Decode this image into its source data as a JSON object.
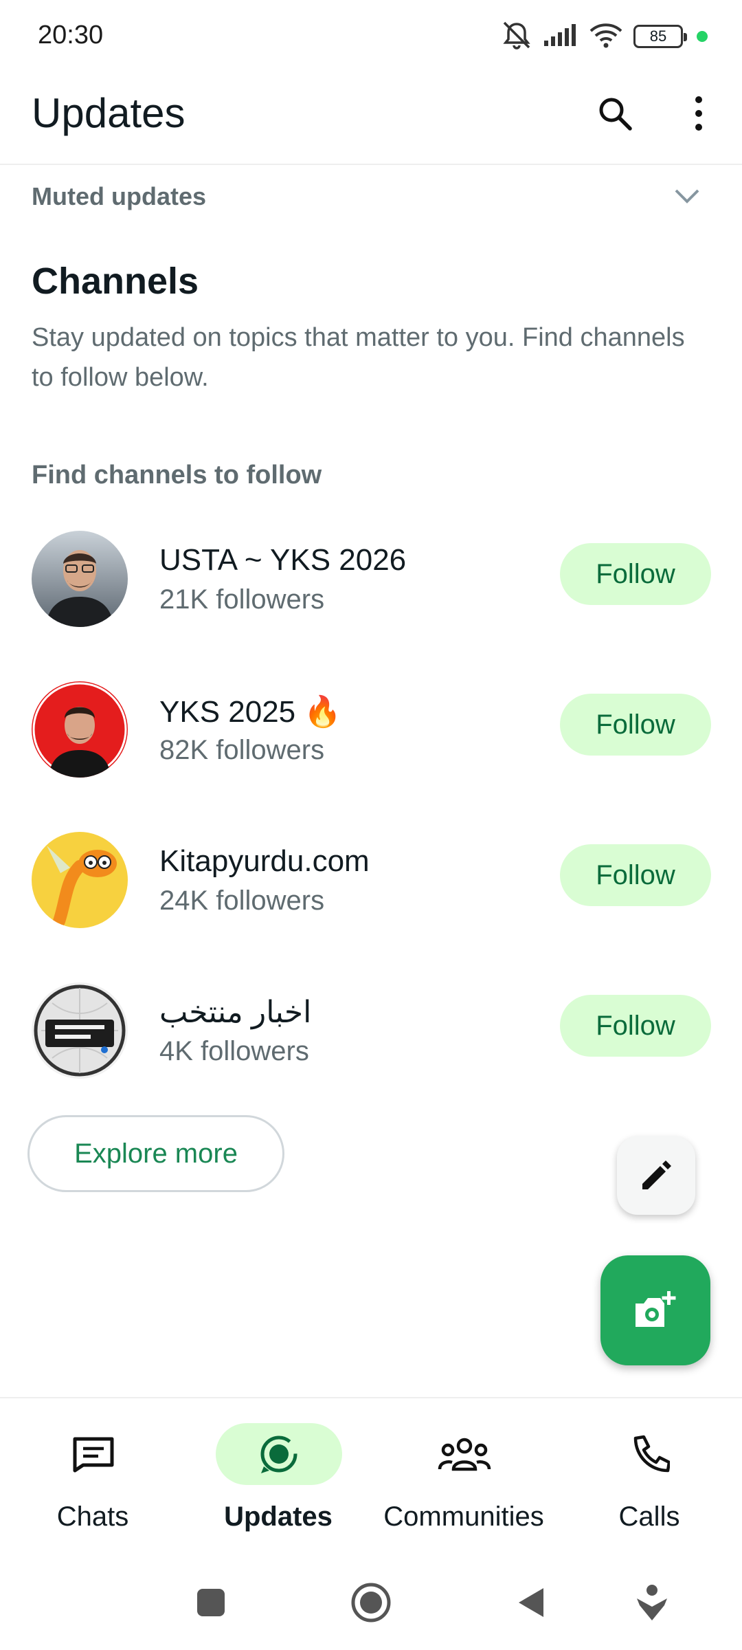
{
  "status_bar": {
    "time": "20:30",
    "battery": "85"
  },
  "header": {
    "title": "Updates"
  },
  "muted": {
    "label": "Muted updates"
  },
  "channels": {
    "title": "Channels",
    "description": "Stay updated on topics that matter to you. Find channels to follow below.",
    "find_label": "Find channels to follow",
    "items": [
      {
        "name": "USTA ~ YKS 2026",
        "followers": "21K followers",
        "button": "Follow"
      },
      {
        "name": "YKS 2025 🔥",
        "followers": "82K followers",
        "button": "Follow"
      },
      {
        "name": "Kitapyurdu.com",
        "followers": "24K followers",
        "button": "Follow"
      },
      {
        "name": "اخبار منتخب",
        "followers": "4K followers",
        "button": "Follow"
      }
    ],
    "explore_label": "Explore more"
  },
  "nav": {
    "items": [
      {
        "label": "Chats",
        "icon": "chat-icon"
      },
      {
        "label": "Updates",
        "icon": "updates-icon"
      },
      {
        "label": "Communities",
        "icon": "communities-icon"
      },
      {
        "label": "Calls",
        "icon": "phone-icon"
      }
    ]
  },
  "colors": {
    "accent": "#21a95c",
    "follow_bg": "#d9fdd3",
    "follow_text": "#0a6b3b",
    "muted_text": "#5f6b70"
  }
}
